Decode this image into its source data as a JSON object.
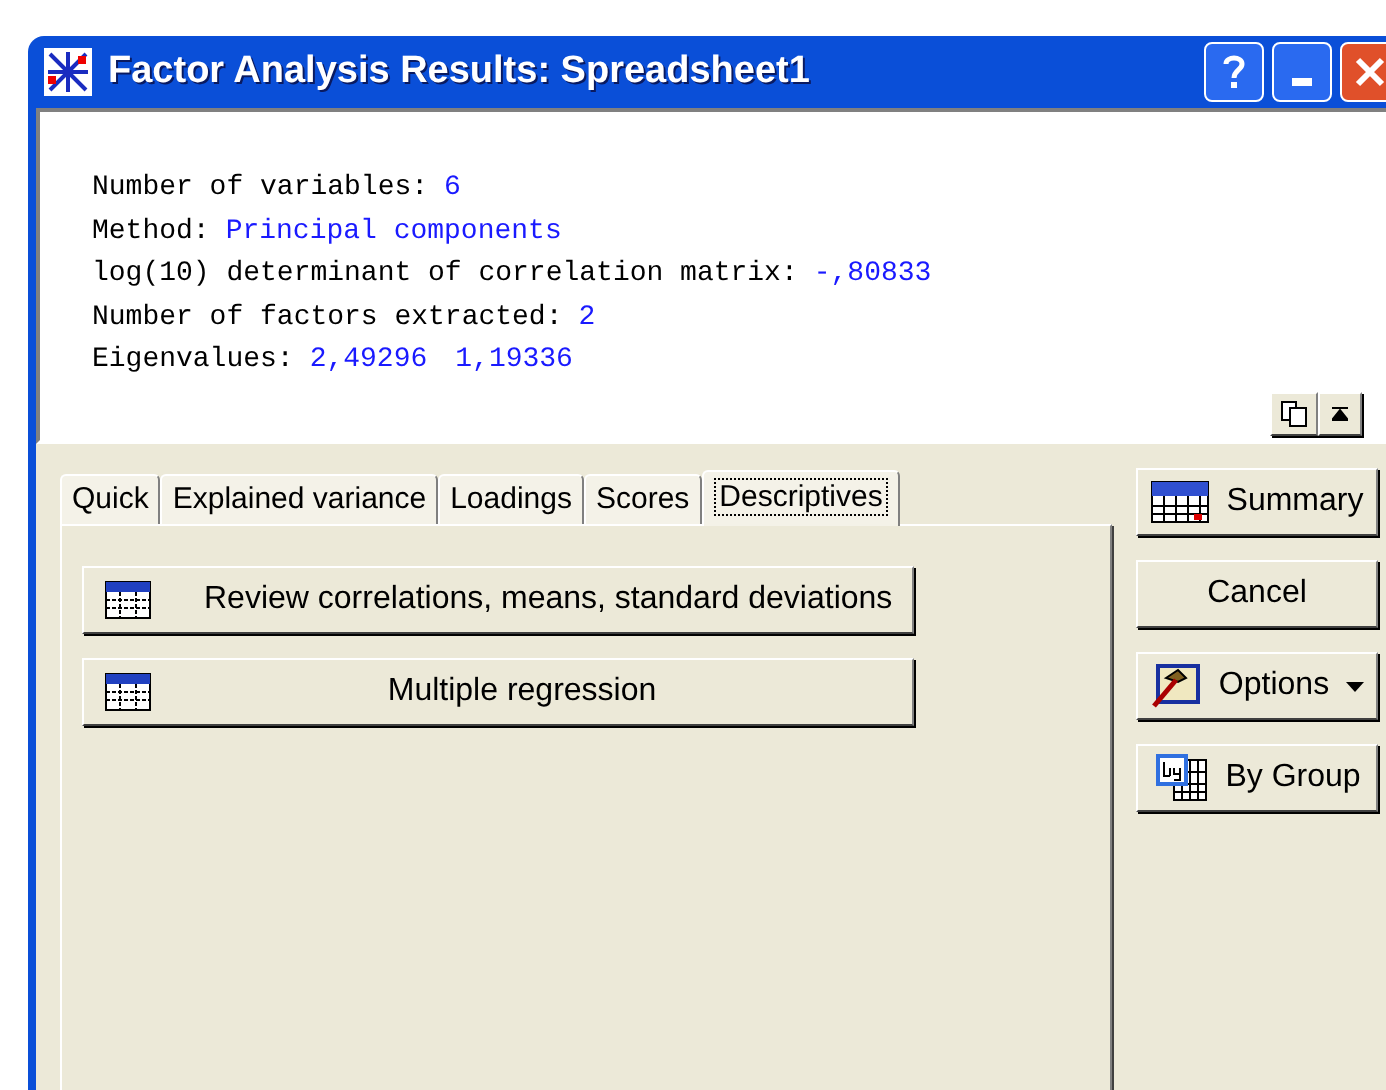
{
  "window": {
    "title": "Factor Analysis Results: Spreadsheet1"
  },
  "output": {
    "lines": [
      {
        "label": "Number of variables:",
        "values": [
          "6"
        ]
      },
      {
        "label": "Method:",
        "values": [
          "Principal components"
        ]
      },
      {
        "label": "log(10) determinant of correlation matrix:",
        "values": [
          "-,80833"
        ]
      },
      {
        "label": "Number of factors extracted:",
        "values": [
          "2"
        ]
      },
      {
        "label": "Eigenvalues:",
        "values": [
          "2,49296",
          "1,19336"
        ]
      }
    ]
  },
  "tabs": [
    {
      "label": "Quick",
      "selected": false
    },
    {
      "label": "Explained variance",
      "selected": false
    },
    {
      "label": "Loadings",
      "selected": false
    },
    {
      "label": "Scores",
      "selected": false
    },
    {
      "label": "Descriptives",
      "selected": true
    }
  ],
  "panel_buttons": [
    {
      "label": "Review correlations, means, standard deviations",
      "kind": "left"
    },
    {
      "label": "Multiple regression",
      "kind": "centered"
    }
  ],
  "side_buttons": [
    {
      "kind": "summary",
      "label": "Summary"
    },
    {
      "kind": "plain",
      "label": "Cancel"
    },
    {
      "kind": "options",
      "label": "Options"
    },
    {
      "kind": "bygroup",
      "label": "By Group"
    }
  ]
}
